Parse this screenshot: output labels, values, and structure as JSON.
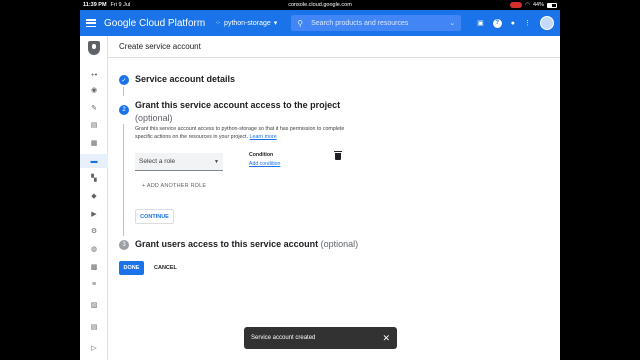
{
  "statusbar": {
    "time": "11:39 PM",
    "date": "Fri 9 Jul",
    "url": "console.cloud.google.com",
    "battery": "44%"
  },
  "header": {
    "product": "Google Cloud Platform",
    "project": "python-storage",
    "search_placeholder": "Search products and resources"
  },
  "page": {
    "title": "Create service account"
  },
  "steps": {
    "one": {
      "title": "Service account details"
    },
    "two": {
      "number": "2",
      "title": "Grant this service account access to the project",
      "optional": "(optional)",
      "description": "Grant this service account access to python-storage so that it has permission to complete specific actions on the resources in your project.",
      "learn_more": "Learn more",
      "role_placeholder": "Select a role",
      "condition_label": "Condition",
      "add_condition": "Add condition",
      "add_another_role": "ADD ANOTHER ROLE",
      "continue": "CONTINUE"
    },
    "three": {
      "number": "3",
      "title": "Grant users access to this service account",
      "optional": "(optional)"
    }
  },
  "actions": {
    "done": "DONE",
    "cancel": "CANCEL"
  },
  "snackbar": {
    "message": "Service account created"
  },
  "colors": {
    "accent": "#1a73e8",
    "header_bg": "#1a73e8"
  }
}
